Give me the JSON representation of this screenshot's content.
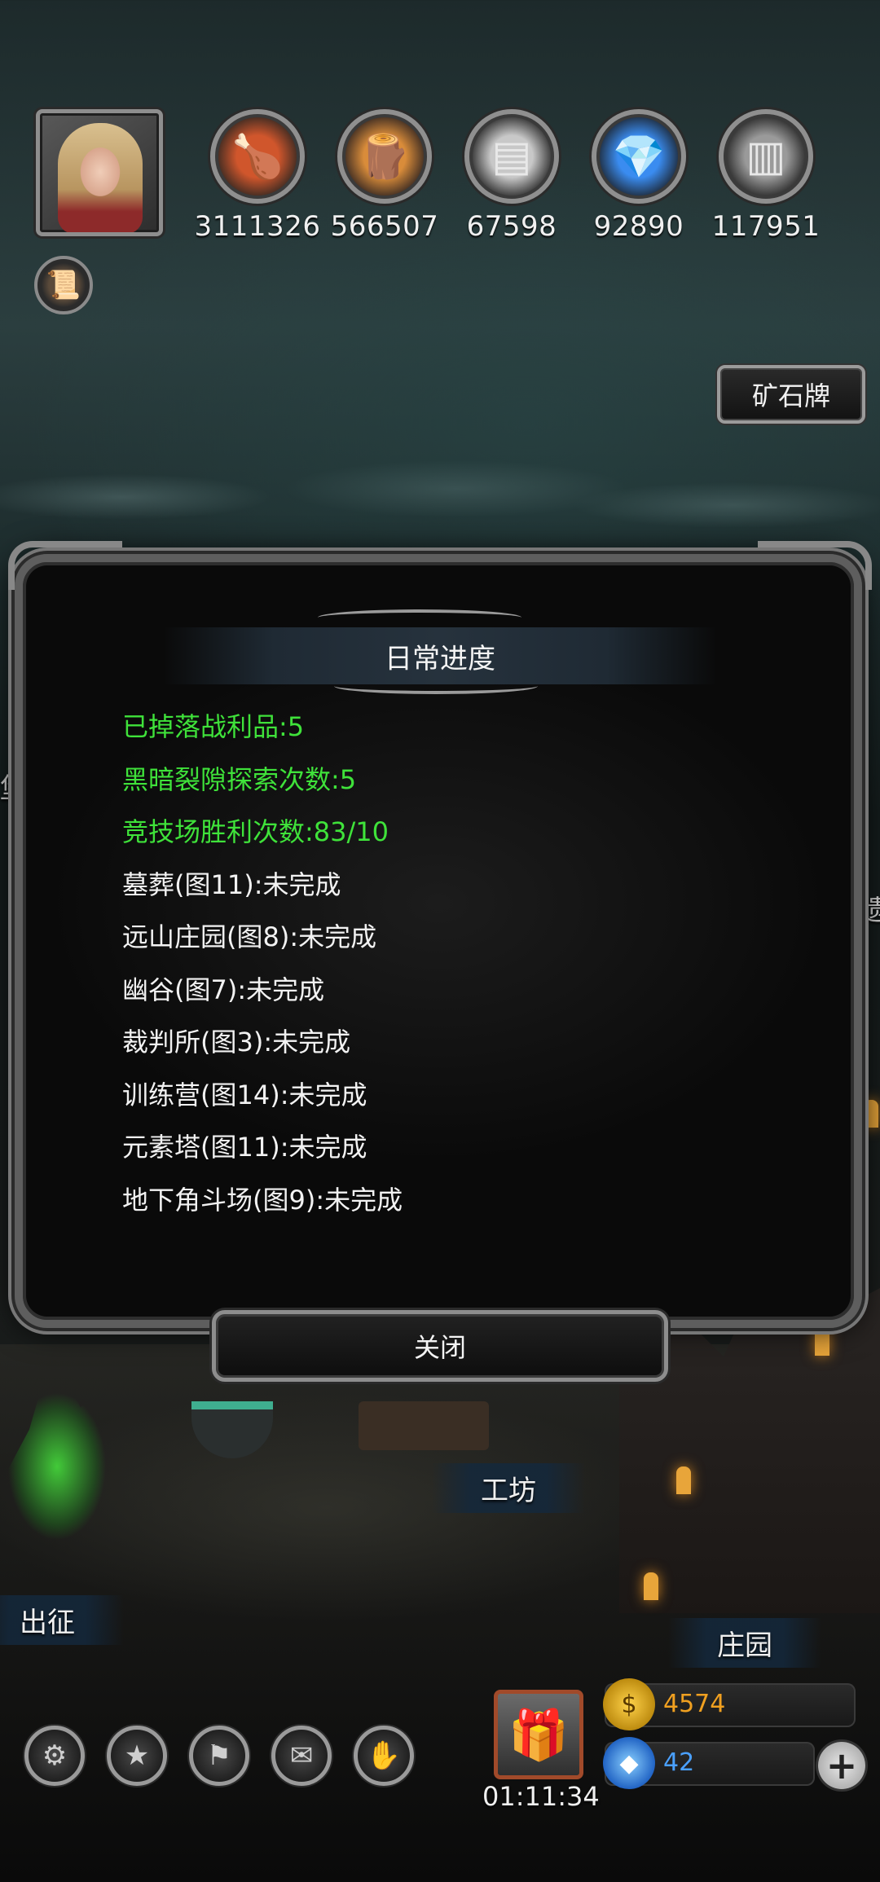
{
  "resources": [
    {
      "icon": "meat-icon",
      "value": "3111326",
      "color": "#c4502a"
    },
    {
      "icon": "wood-icon",
      "value": "566507",
      "color": "#d98c3a"
    },
    {
      "icon": "iron-icon",
      "value": "67598",
      "color": "#b9b9b9"
    },
    {
      "icon": "crystal-icon",
      "value": "92890",
      "color": "#3a8cf0"
    },
    {
      "icon": "steel-icon",
      "value": "117951",
      "color": "#9a9a9a"
    }
  ],
  "ore_button": "矿石牌",
  "dialog": {
    "title": "日常进度",
    "lines": [
      {
        "text": "已掉落战利品:5",
        "style": "green"
      },
      {
        "text": "黑暗裂隙探索次数:5",
        "style": "green"
      },
      {
        "text": "竞技场胜利次数:83/10",
        "style": "green"
      },
      {
        "text": "墓葬(图11):未完成",
        "style": "white"
      },
      {
        "text": "远山庄园(图8):未完成",
        "style": "white"
      },
      {
        "text": "幽谷(图7):未完成",
        "style": "white"
      },
      {
        "text": "裁判所(图3):未完成",
        "style": "white"
      },
      {
        "text": "训练营(图14):未完成",
        "style": "white"
      },
      {
        "text": "元素塔(图11):未完成",
        "style": "white"
      },
      {
        "text": "地下角斗场(图9):未完成",
        "style": "white"
      }
    ],
    "close_label": "关闭"
  },
  "map": {
    "workshop": "工坊",
    "expedition": "出征",
    "manor": "庄园",
    "left_edge": "堡",
    "right_edge": "遗"
  },
  "bottom": {
    "timer": "01:11:34",
    "gold": "4574",
    "gems": "42",
    "gold_color": "#f0a020",
    "gem_color": "#4aa0ff"
  }
}
